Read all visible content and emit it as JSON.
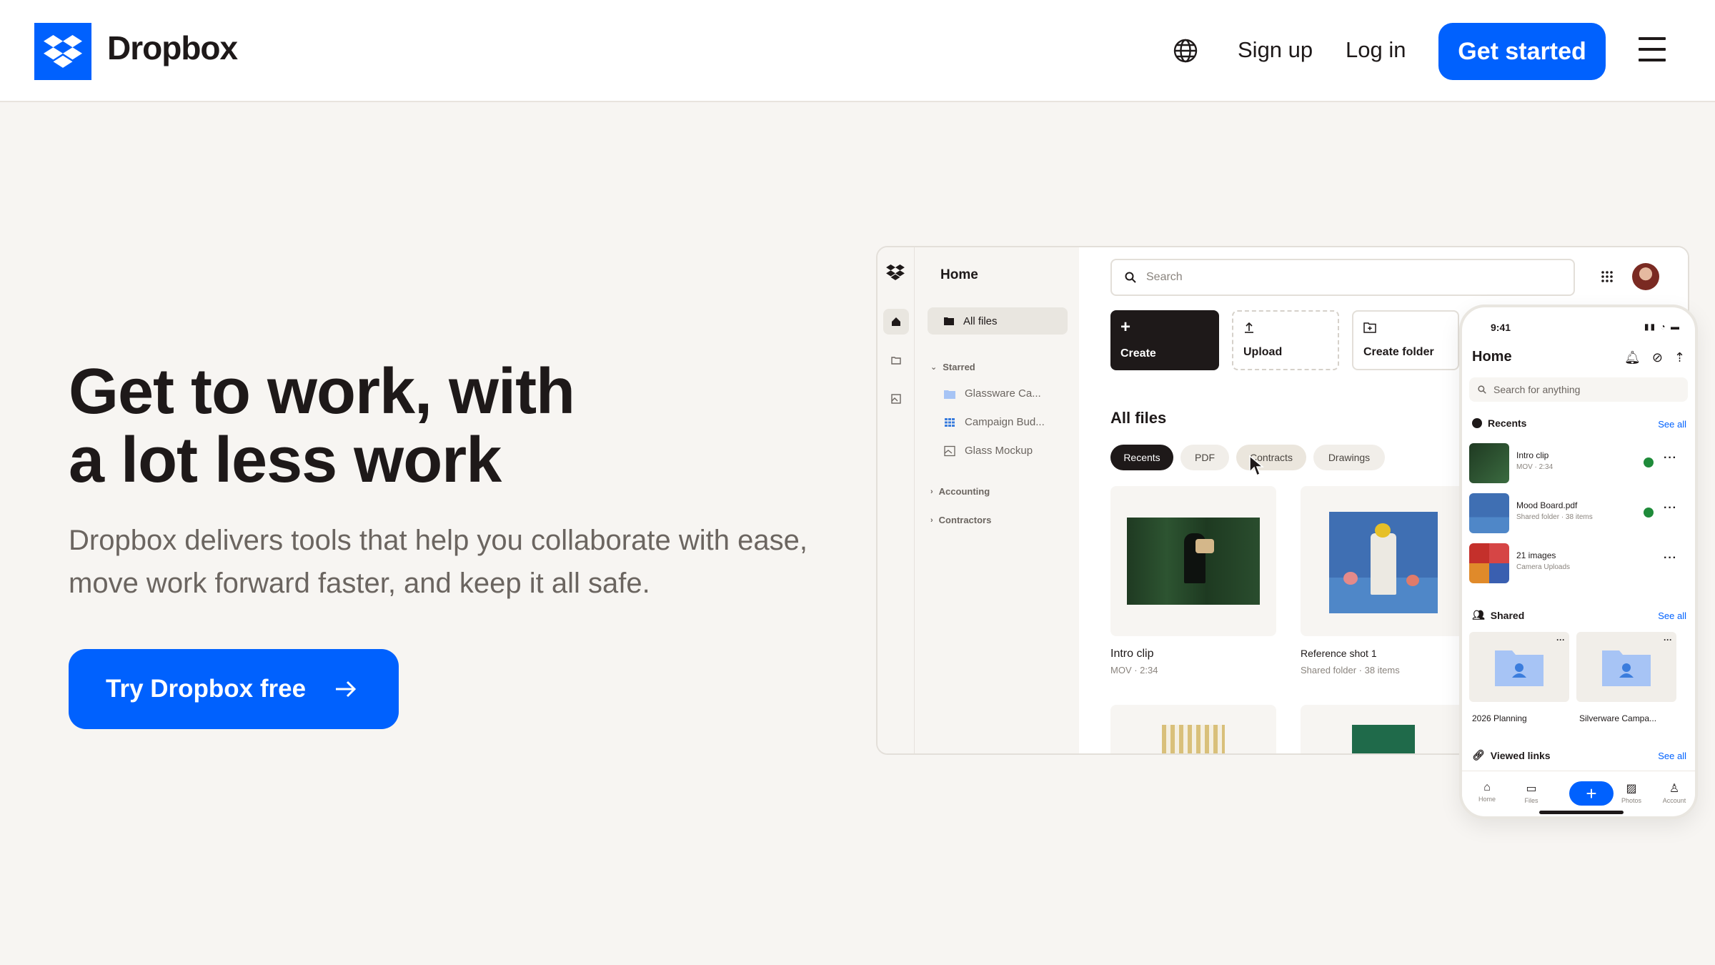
{
  "header": {
    "brand": "Dropbox",
    "signup": "Sign up",
    "login": "Log in",
    "get_started": "Get started"
  },
  "hero": {
    "title_line1": "Get to work, with",
    "title_line2": "a lot less work",
    "subtitle": "Dropbox delivers tools that help you collaborate with ease, move work forward faster, and keep it all safe.",
    "cta": "Try Dropbox free"
  },
  "app": {
    "sidebar": {
      "title": "Home",
      "all_files": "All files",
      "starred": "Starred",
      "starred_items": [
        "Glassware Ca...",
        "Campaign Bud...",
        "Glass Mockup"
      ],
      "accounting": "Accounting",
      "contractors": "Contractors"
    },
    "search_placeholder": "Search",
    "actions": {
      "create": "Create",
      "upload": "Upload",
      "create_folder": "Create folder"
    },
    "main_title": "All files",
    "chips": [
      "Recents",
      "PDF",
      "Contracts",
      "Drawings"
    ],
    "cards": [
      {
        "title": "Intro clip",
        "meta": "MOV · 2:34"
      },
      {
        "title": "Reference shot 1",
        "meta": "Shared folder · 38 items"
      }
    ]
  },
  "phone": {
    "time": "9:41",
    "title": "Home",
    "search_placeholder": "Search for anything",
    "recents": "Recents",
    "see_all": "See all",
    "recent_items": [
      {
        "title": "Intro clip",
        "meta": "MOV · 2:34"
      },
      {
        "title": "Mood Board.pdf",
        "meta": "Shared folder · 38 items"
      },
      {
        "title": "21 images",
        "meta": "Camera Uploads"
      }
    ],
    "shared": "Shared",
    "shared_items": [
      "2026 Planning",
      "Silverware Campa..."
    ],
    "viewed_links": "Viewed links",
    "nav": [
      "Home",
      "Files",
      "Photos",
      "Account"
    ]
  },
  "colors": {
    "brand_blue": "#0061fe",
    "ink": "#1e1919",
    "canvas": "#f7f5f2"
  }
}
